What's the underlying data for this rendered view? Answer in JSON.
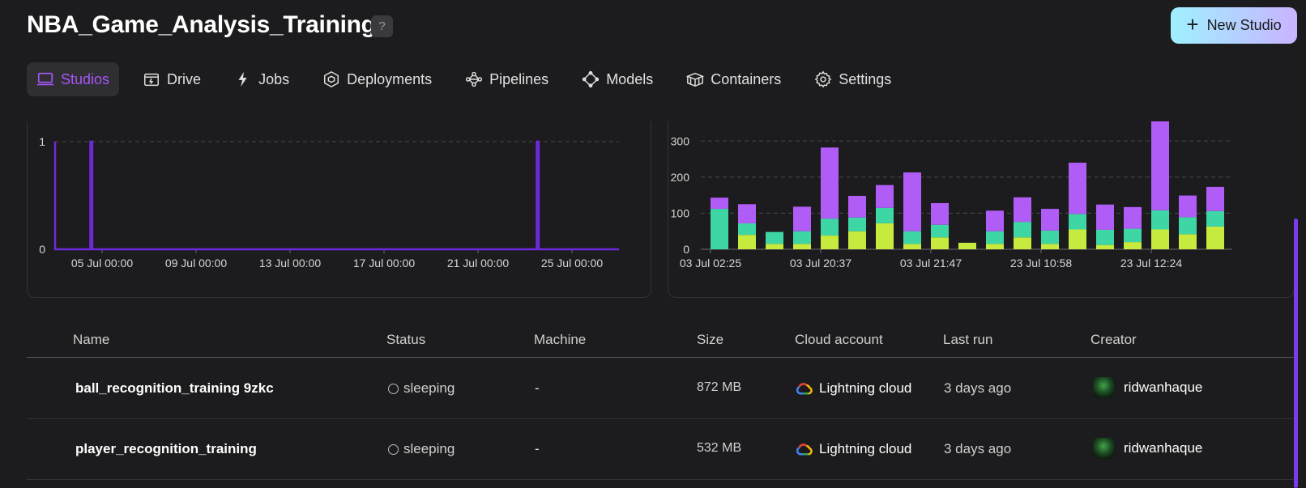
{
  "header": {
    "title": "NBA_Game_Analysis_Training",
    "help_label": "?",
    "new_studio_label": "New Studio"
  },
  "tabs": [
    {
      "label": "Studios",
      "icon": "laptop-icon",
      "active": true
    },
    {
      "label": "Drive",
      "icon": "drive-icon",
      "active": false
    },
    {
      "label": "Jobs",
      "icon": "lightning-icon",
      "active": false
    },
    {
      "label": "Deployments",
      "icon": "cube-icon",
      "active": false
    },
    {
      "label": "Pipelines",
      "icon": "pipeline-icon",
      "active": false
    },
    {
      "label": "Models",
      "icon": "model-icon",
      "active": false
    },
    {
      "label": "Containers",
      "icon": "container-icon",
      "active": false
    },
    {
      "label": "Settings",
      "icon": "gear-icon",
      "active": false
    }
  ],
  "colors": {
    "accent": "#a855f7",
    "line": "#6d28d9",
    "bar_purple": "#b05cf7",
    "bar_teal": "#3fd6a6",
    "bar_lime": "#c6ea3e"
  },
  "chart_data": [
    {
      "type": "line",
      "title": "",
      "ylim": [
        0,
        1
      ],
      "y_ticks": [
        "0",
        "1"
      ],
      "x_ticks": [
        "05 Jul 00:00",
        "09 Jul 00:00",
        "13 Jul 00:00",
        "17 Jul 00:00",
        "21 Jul 00:00",
        "25 Jul 00:00"
      ],
      "grid": true,
      "series": [
        {
          "points": [
            [
              "03 Jul 00:00",
              1
            ],
            [
              "03 Jul 00:00",
              0
            ],
            [
              "04 Jul 12:00",
              0
            ],
            [
              "04 Jul 12:00",
              1
            ],
            [
              "04 Jul 14:00",
              1
            ],
            [
              "04 Jul 14:00",
              0
            ],
            [
              "23 Jul 12:00",
              0
            ],
            [
              "23 Jul 12:00",
              1
            ],
            [
              "23 Jul 14:00",
              1
            ],
            [
              "23 Jul 14:00",
              0
            ],
            [
              "27 Jul 00:00",
              0
            ]
          ]
        }
      ]
    },
    {
      "type": "bar",
      "title": "",
      "ylim": [
        0,
        350
      ],
      "y_ticks": [
        "0",
        "100",
        "200",
        "300"
      ],
      "x_ticks": [
        "03 Jul 02:25",
        "03 Jul 20:37",
        "03 Jul 21:47",
        "23 Jul 10:58",
        "23 Jul 12:24"
      ],
      "stacked": true,
      "grid": true,
      "series": [
        {
          "color": "#c6ea3e",
          "values": [
            0,
            40,
            15,
            15,
            38,
            50,
            72,
            15,
            33,
            18,
            15,
            33,
            15,
            55,
            12,
            20,
            55,
            42,
            63
          ]
        },
        {
          "color": "#3fd6a6",
          "values": [
            112,
            32,
            33,
            35,
            47,
            38,
            43,
            35,
            35,
            0,
            35,
            43,
            37,
            43,
            42,
            37,
            53,
            47,
            43
          ]
        },
        {
          "color": "#b05cf7",
          "values": [
            31,
            53,
            0,
            68,
            197,
            60,
            63,
            163,
            60,
            0,
            57,
            68,
            60,
            142,
            70,
            60,
            250,
            60,
            67
          ]
        }
      ]
    }
  ],
  "table": {
    "columns": [
      "Name",
      "Status",
      "Machine",
      "Size",
      "Cloud account",
      "Last run",
      "Creator"
    ],
    "rows": [
      {
        "name": "ball_recognition_training 9zkc",
        "status": "sleeping",
        "machine": "-",
        "size": "872 MB",
        "cloud": "Lightning cloud",
        "last_run": "3 days ago",
        "creator": "ridwanhaque"
      },
      {
        "name": "player_recognition_training",
        "status": "sleeping",
        "machine": "-",
        "size": "532 MB",
        "cloud": "Lightning cloud",
        "last_run": "3 days ago",
        "creator": "ridwanhaque"
      }
    ]
  }
}
